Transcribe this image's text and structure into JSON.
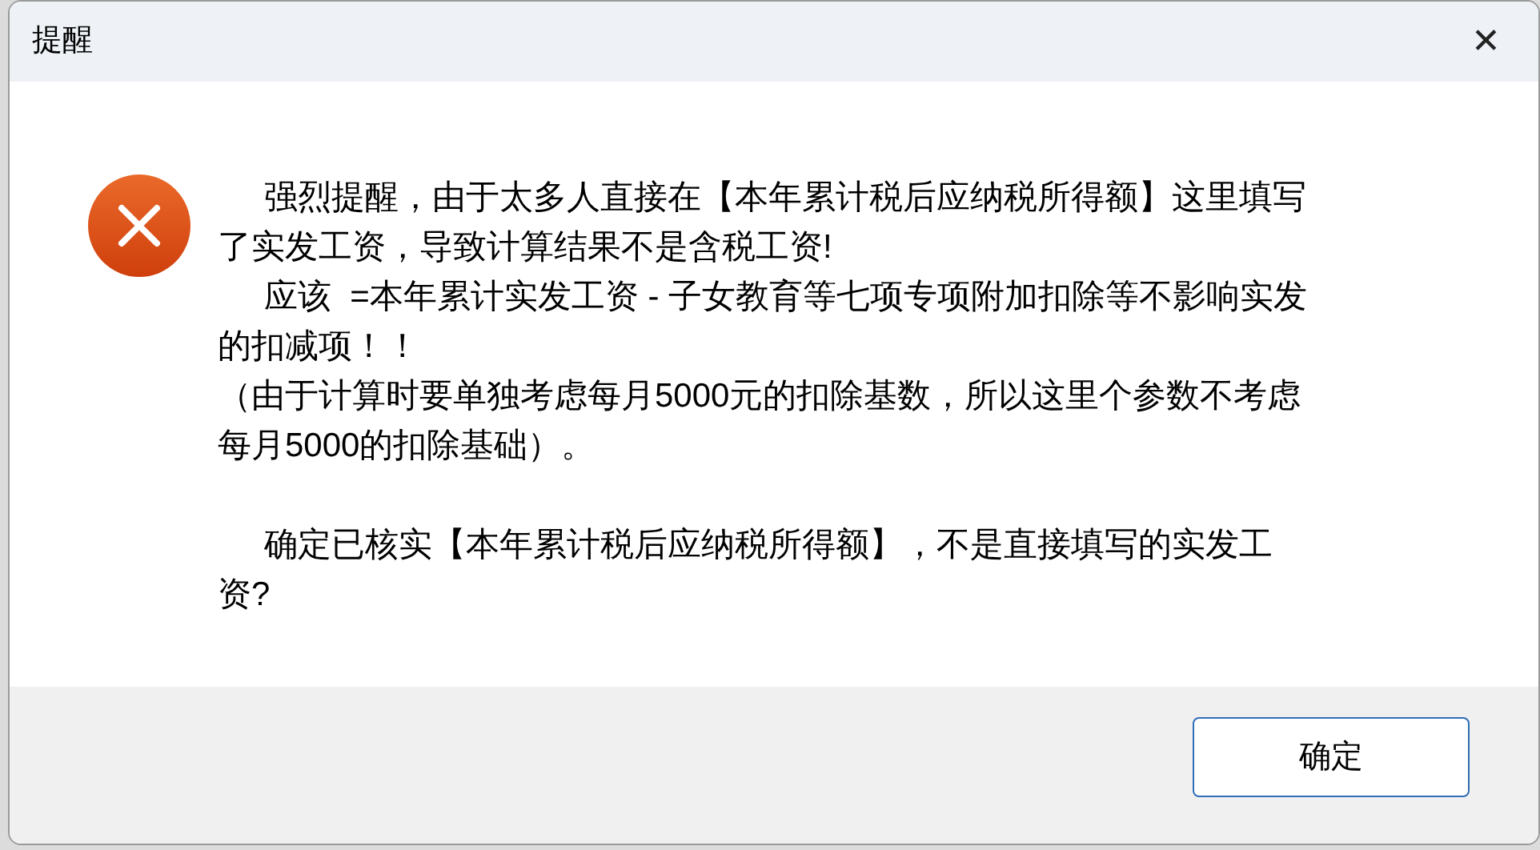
{
  "window": {
    "title": "提醒",
    "close": "✕"
  },
  "message": [
    {
      "kind": "paragraph",
      "indent": true,
      "lines": [
        "强烈提醒，由于太多人直接在【本年累计税后应纳税所得额】这里填写",
        "了实发工资，导致计算结果不是含税工资!"
      ]
    },
    {
      "kind": "paragraph",
      "indent": true,
      "lines": [
        "应该  =本年累计实发工资 - 子女教育等七项专项附加扣除等不影响实发",
        "的扣减项！！"
      ]
    },
    {
      "kind": "paragraph",
      "indent": false,
      "lines": [
        "（由于计算时要单独考虑每月5000元的扣除基数，所以这里个参数不考虑",
        "每月5000的扣除基础）。"
      ]
    },
    {
      "kind": "blank"
    },
    {
      "kind": "paragraph",
      "indent": true,
      "lines": [
        "确定已核实【本年累计税后应纳税所得额】，不是直接填写的实发工",
        "资?"
      ]
    }
  ],
  "buttons": [
    {
      "label": "确定",
      "selected": true
    }
  ]
}
